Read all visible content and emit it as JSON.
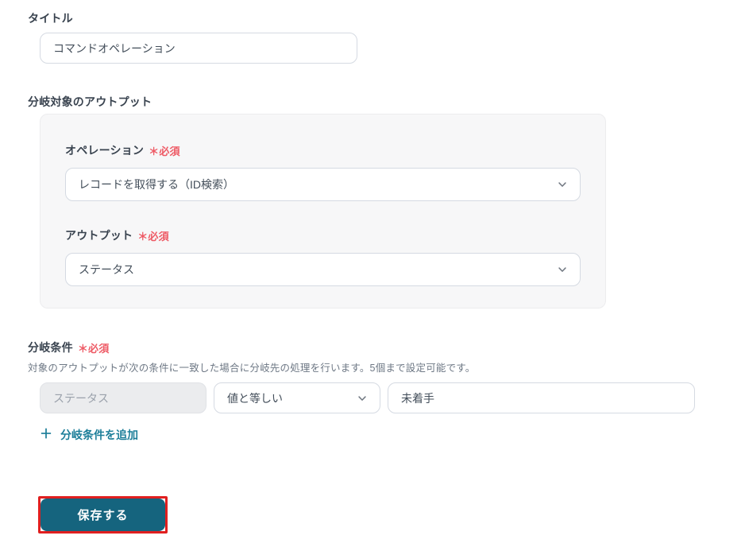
{
  "colors": {
    "button_teal": "#15647e",
    "link_teal": "#1c7e99",
    "required_red": "#ee5a65",
    "annotation_red": "#e01f1f",
    "panel_bg": "#f7f7f8"
  },
  "form": {
    "title_field": {
      "label": "タイトル",
      "value": "コマンドオペレーション"
    },
    "branch_output": {
      "heading": "分岐対象のアウトプット",
      "operation": {
        "label": "オペレーション",
        "required": "＊必須",
        "selected": "レコードを取得する（ID検索）"
      },
      "output": {
        "label": "アウトプット",
        "required": "＊必須",
        "selected": "ステータス"
      }
    },
    "branch_condition": {
      "heading": "分岐条件",
      "required": "＊必須",
      "description": "対象のアウトプットが次の条件に一致した場合に分岐先の処理を行います。5個まで設定可能です。",
      "row": {
        "target_value": "ステータス",
        "operator_selected": "値と等しい",
        "value": "未着手"
      },
      "add_link": {
        "icon": "＋",
        "label": "分岐条件を追加"
      }
    },
    "save": {
      "label": "保存する"
    }
  }
}
